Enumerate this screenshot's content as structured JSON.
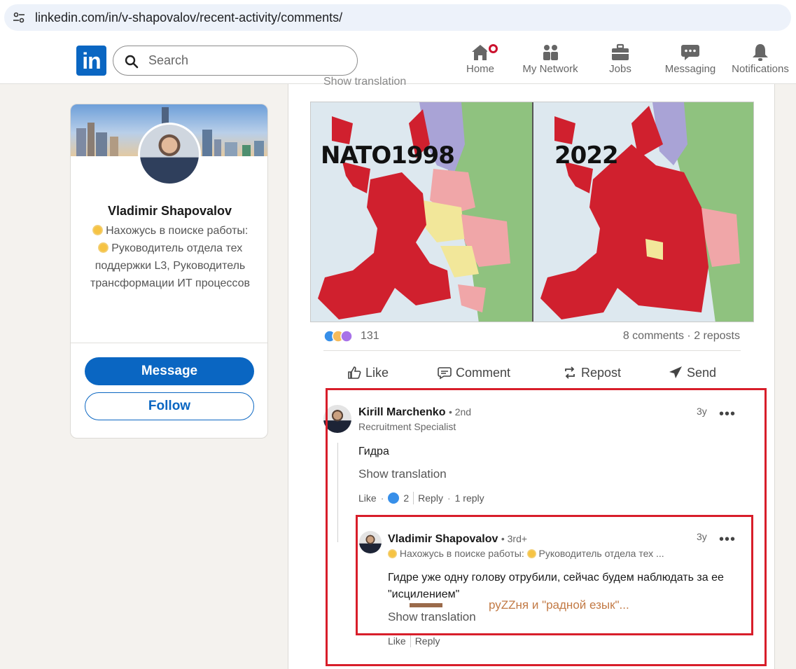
{
  "browser": {
    "url": "linkedin.com/in/v-shapovalov/recent-activity/comments/"
  },
  "nav": {
    "logo": "in",
    "search_placeholder": "Search",
    "items": [
      {
        "label": "Home",
        "icon": "home-icon"
      },
      {
        "label": "My Network",
        "icon": "people-icon"
      },
      {
        "label": "Jobs",
        "icon": "briefcase-icon"
      },
      {
        "label": "Messaging",
        "icon": "chat-icon"
      },
      {
        "label": "Notifications",
        "icon": "bell-icon"
      }
    ]
  },
  "profile": {
    "name": "Vladimir Shapovalov",
    "headline_1": "Нахожусь в поиске работы:",
    "headline_2": "Руководитель отдела тех поддержки L3, Руководитель трансформации ИТ процессов",
    "message_label": "Message",
    "follow_label": "Follow"
  },
  "post": {
    "top_text": "Show translation",
    "map_left_title": "NATO1998",
    "map_right_title": "2022",
    "reactions_count": "131",
    "comments_reposts": "8 comments · 2 reposts",
    "actions": {
      "like": "Like",
      "comment": "Comment",
      "repost": "Repost",
      "send": "Send"
    }
  },
  "comment": {
    "author": "Kirill Marchenko",
    "degree": "• 2nd",
    "subtitle": "Recruitment Specialist",
    "time": "3y",
    "text": "Гидра",
    "show_translation": "Show translation",
    "like": "Like",
    "like_count": "2",
    "reply": "Reply",
    "replies": "1 reply"
  },
  "reply": {
    "author": "Vladimir Shapovalov",
    "degree": "• 3rd+",
    "subtitle_1": "Нахожусь в поиске работы:",
    "subtitle_2": "Руководитель отдела тех ...",
    "time": "3y",
    "text": "Гидре уже одну голову отрубили, сейчас будем наблюдать за ее \"исцилением\"",
    "show_translation": "Show translation",
    "like": "Like",
    "reply": "Reply"
  },
  "annotation": {
    "text": "руZZня и \"радной езык\"..."
  },
  "colors": {
    "linkedin_blue": "#0a66c2",
    "highlight_red": "#d81e2a",
    "annotation_brown": "#c27a45",
    "map_red": "#d0202e"
  }
}
